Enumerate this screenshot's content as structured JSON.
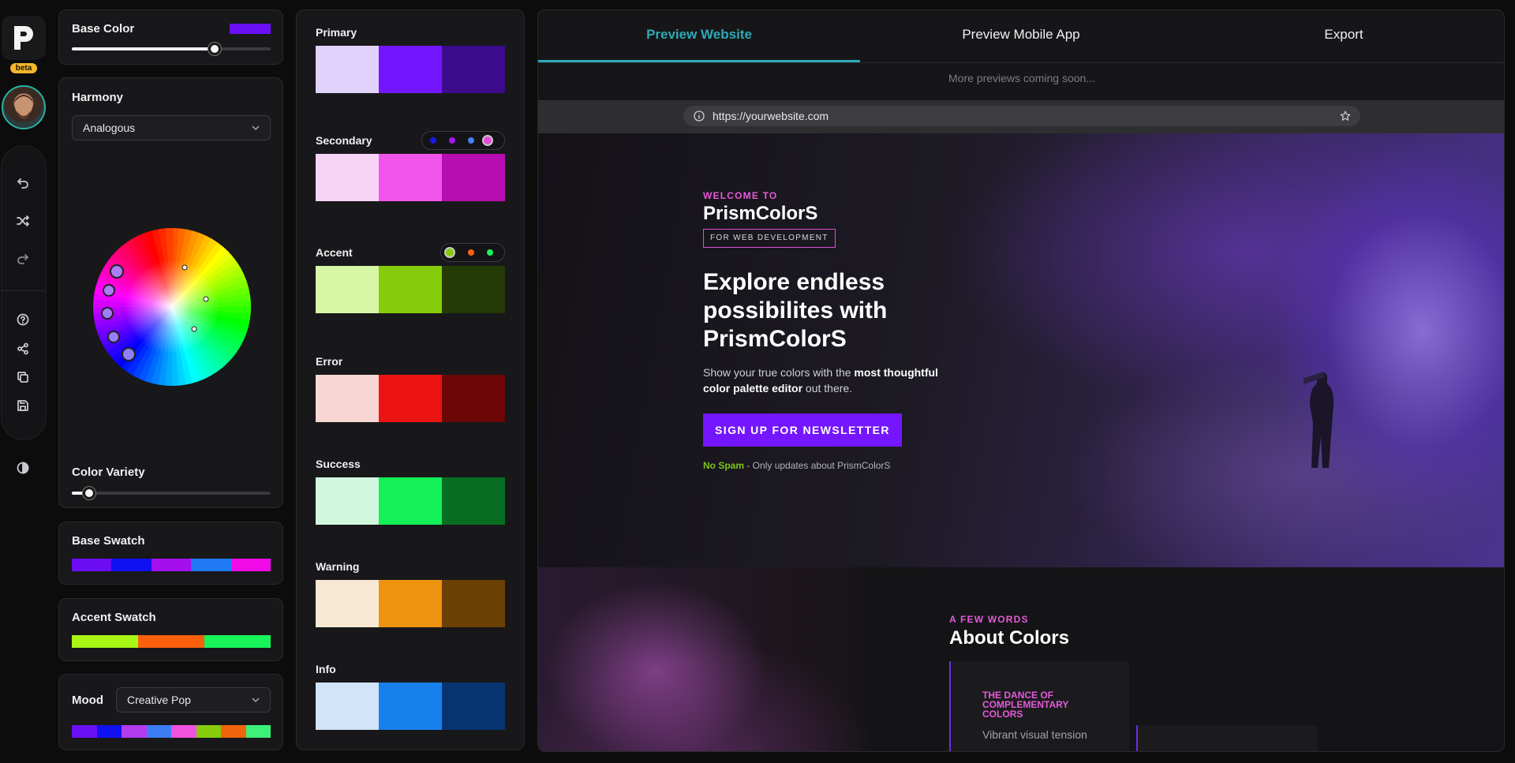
{
  "rail": {
    "logo_letter": "P",
    "beta_label": "beta",
    "icons": [
      "undo-icon",
      "shuffle-icon",
      "redo-icon",
      "help-icon",
      "share-icon",
      "copy-icon",
      "save-icon",
      "contrast-icon"
    ]
  },
  "settings": {
    "base_color": {
      "label": "Base Color",
      "color": "#6b0ff5",
      "slider": 0.72
    },
    "harmony": {
      "label": "Harmony",
      "selected": "Analogous"
    },
    "color_variety": {
      "label": "Color Variety",
      "slider": 0.11
    },
    "base_swatch": {
      "label": "Base Swatch",
      "colors": [
        "#6c0cf5",
        "#1110f0",
        "#a50ff0",
        "#2079f5",
        "#f00be8"
      ]
    },
    "accent_swatch": {
      "label": "Accent Swatch",
      "colors": [
        "#a8f516",
        "#fa600c",
        "#18f55a"
      ]
    },
    "mood": {
      "label": "Mood",
      "selected": "Creative Pop",
      "colors": [
        "#6b0ff5",
        "#1110f0",
        "#b23bf0",
        "#3c7df5",
        "#f052e0",
        "#86cc0c",
        "#f0640c",
        "#3cf07a"
      ]
    }
  },
  "palette": [
    {
      "label": "Primary",
      "colors": [
        "#e1d2fb",
        "#7316ff",
        "#3b0b8c"
      ],
      "variants": []
    },
    {
      "label": "Secondary",
      "colors": [
        "#f7d3f6",
        "#f255ec",
        "#b80db1"
      ],
      "variants": [
        "#1a18f0",
        "#a715f5",
        "#4a7ff5",
        "#e64dd8"
      ]
    },
    {
      "label": "Accent",
      "colors": [
        "#d7f6a6",
        "#86cc0b",
        "#243a07"
      ],
      "variants": [
        "#86cc0b",
        "#fa600c",
        "#18f55a"
      ]
    },
    {
      "label": "Error",
      "colors": [
        "#f8d6d4",
        "#ec1313",
        "#6b0707"
      ],
      "variants": []
    },
    {
      "label": "Success",
      "colors": [
        "#d2f7df",
        "#14f058",
        "#076d23"
      ],
      "variants": []
    },
    {
      "label": "Warning",
      "colors": [
        "#f8e8d3",
        "#ee9310",
        "#6b4106"
      ],
      "variants": []
    },
    {
      "label": "Info",
      "colors": [
        "#d2e4f8",
        "#1780ed",
        "#053470"
      ],
      "variants": []
    }
  ],
  "preview": {
    "tabs": [
      "Preview Website",
      "Preview Mobile App",
      "Export"
    ],
    "active_tab": "Preview Website",
    "coming_soon": "More previews coming soon...",
    "url": "https://yourwebsite.com",
    "hero": {
      "kicker": "WELCOME TO",
      "brand": "PrismColorS",
      "tag": "FOR WEB DEVELOPMENT",
      "title": "Explore endless possibilites with PrismColorS",
      "body_pre": "Show your true colors with the ",
      "body_bold": "most thoughtful color palette editor",
      "body_post": " out there.",
      "cta": "SIGN UP FOR NEWSLETTER",
      "nospam": "No Spam",
      "nospam_rest": " - Only updates about PrismColorS"
    },
    "about": {
      "kicker": "A FEW WORDS",
      "title": "About Colors",
      "card_title": "THE DANCE OF COMPLEMENTARY COLORS",
      "card_text": "Vibrant visual tension"
    }
  }
}
